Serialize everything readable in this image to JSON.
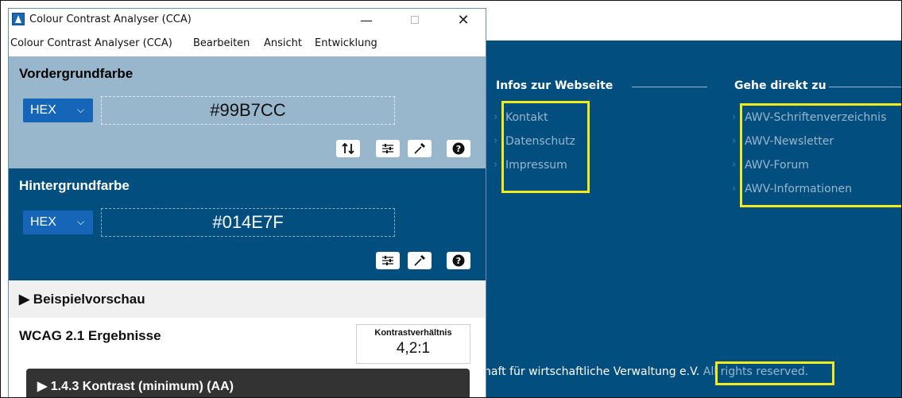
{
  "website": {
    "columns": [
      {
        "heading": "Infos zur Webseite",
        "links": [
          "Kontakt",
          "Datenschutz",
          "Impressum"
        ]
      },
      {
        "heading": "Gehe direkt zu",
        "links": [
          "AWV-Schriftenverzeichnis",
          "AWV-Newsletter",
          "AWV-Forum",
          "AWV-Informationen"
        ]
      }
    ],
    "footer_text": "haft für wirtschaftliche Verwaltung e.V.",
    "footer_rights": "All rights reserved.",
    "highlight_color": "#f2ea1a",
    "background_color": "#014E7F",
    "text_color": "#99B7CC"
  },
  "cca": {
    "window_title": "Colour Contrast Analyser (CCA)",
    "menu": [
      "Colour Contrast Analyser (CCA)",
      "Bearbeiten",
      "Ansicht",
      "Entwicklung"
    ],
    "window_controls": {
      "minimize": "—",
      "close": "✕"
    },
    "foreground": {
      "title": "Vordergrundfarbe",
      "format": "HEX",
      "value": "#99B7CC",
      "color": "#99B7CC",
      "tools": [
        "swap-icon",
        "sliders-icon",
        "eyedropper-icon",
        "help-icon"
      ]
    },
    "background": {
      "title": "Hintergrundfarbe",
      "format": "HEX",
      "value": "#014E7F",
      "color": "#014E7F",
      "tools": [
        "sliders-icon",
        "eyedropper-icon",
        "help-icon"
      ]
    },
    "preview": {
      "label": "Beispielvorschau"
    },
    "results": {
      "title": "WCAG 2.1 Ergebnisse",
      "ratio_label": "Kontrastverhältnis",
      "ratio_value": "4,2:1",
      "criterion": "1.4.3 Kontrast (minimum) (AA)"
    }
  }
}
